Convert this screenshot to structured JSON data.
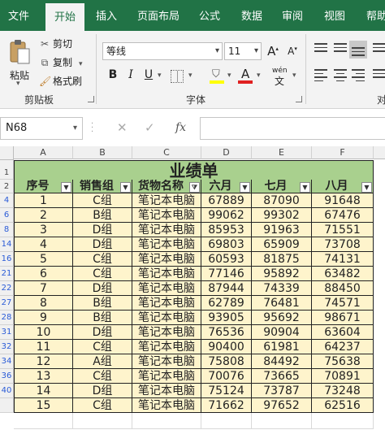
{
  "tabs": [
    "文件",
    "开始",
    "插入",
    "页面布局",
    "公式",
    "数据",
    "审阅",
    "视图",
    "帮助"
  ],
  "active_tab": "开始",
  "clipboard": {
    "paste_label": "粘贴",
    "cut_label": "剪切",
    "copy_label": "复制",
    "format_painter_label": "格式刷",
    "group_label": "剪贴板"
  },
  "font": {
    "name": "等线",
    "size": "11",
    "group_label": "字体",
    "bold": "B",
    "italic": "I",
    "underline": "U",
    "grow": "A",
    "shrink": "A",
    "wen": "wén",
    "fill_letter": "A"
  },
  "alignment": {
    "group_label": "对"
  },
  "colors": {
    "accent": "#217346",
    "header_fill": "#a9d08e",
    "data_fill": "#fef4cc",
    "highlight_yellow": "#ffff00",
    "font_red": "#e02020"
  },
  "formula_bar": {
    "name_box": "N68",
    "fx": "fx",
    "formula": ""
  },
  "sheet": {
    "columns": [
      "A",
      "B",
      "C",
      "D",
      "E",
      "F"
    ],
    "row_numbers": [
      "1",
      "2",
      "4",
      "6",
      "8",
      "14",
      "16",
      "21",
      "22",
      "27",
      "28",
      "31",
      "32",
      "34",
      "36",
      "40",
      ""
    ],
    "title": "业绩单",
    "headers": [
      "序号",
      "销售组",
      "货物名称",
      "六月",
      "七月",
      "八月"
    ],
    "rows": [
      [
        "1",
        "C组",
        "笔记本电脑",
        "67889",
        "87090",
        "91648"
      ],
      [
        "2",
        "B组",
        "笔记本电脑",
        "99062",
        "99302",
        "67476"
      ],
      [
        "3",
        "D组",
        "笔记本电脑",
        "85953",
        "91963",
        "71551"
      ],
      [
        "4",
        "D组",
        "笔记本电脑",
        "69803",
        "65909",
        "73708"
      ],
      [
        "5",
        "C组",
        "笔记本电脑",
        "60593",
        "81875",
        "74131"
      ],
      [
        "6",
        "C组",
        "笔记本电脑",
        "77146",
        "95892",
        "63482"
      ],
      [
        "7",
        "D组",
        "笔记本电脑",
        "87944",
        "74339",
        "88450"
      ],
      [
        "8",
        "B组",
        "笔记本电脑",
        "62789",
        "76481",
        "74571"
      ],
      [
        "9",
        "B组",
        "笔记本电脑",
        "93905",
        "95692",
        "98671"
      ],
      [
        "10",
        "D组",
        "笔记本电脑",
        "76536",
        "90904",
        "63604"
      ],
      [
        "11",
        "C组",
        "笔记本电脑",
        "90400",
        "61981",
        "64237"
      ],
      [
        "12",
        "A组",
        "笔记本电脑",
        "75808",
        "84492",
        "75638"
      ],
      [
        "13",
        "C组",
        "笔记本电脑",
        "70076",
        "73665",
        "70891"
      ],
      [
        "14",
        "D组",
        "笔记本电脑",
        "75124",
        "73787",
        "73248"
      ],
      [
        "15",
        "C组",
        "笔记本电脑",
        "71662",
        "97652",
        "62516"
      ]
    ]
  }
}
